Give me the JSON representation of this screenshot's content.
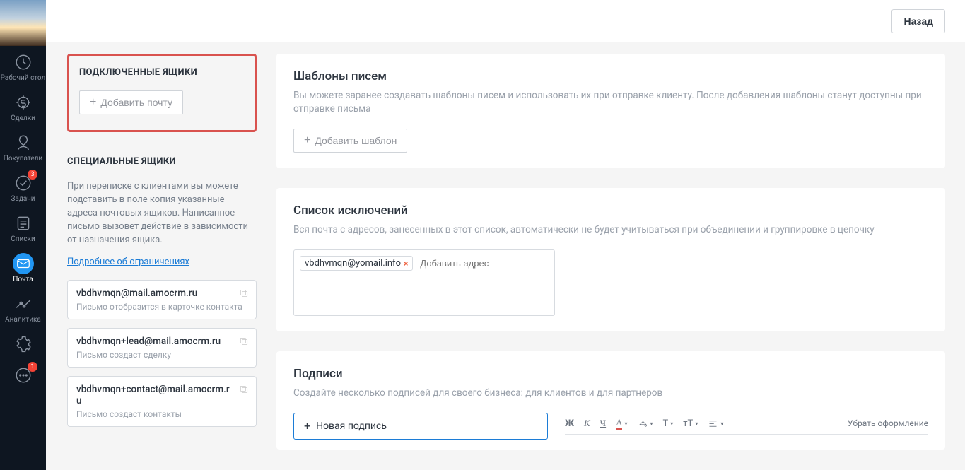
{
  "sidebar": {
    "items": [
      {
        "label": "Рабочий стол",
        "badge": null
      },
      {
        "label": "Сделки",
        "badge": null
      },
      {
        "label": "Покупатели",
        "badge": null
      },
      {
        "label": "Задачи",
        "badge": "3"
      },
      {
        "label": "Списки",
        "badge": null
      },
      {
        "label": "Почта",
        "badge": null
      },
      {
        "label": "Аналитика",
        "badge": null
      },
      {
        "label": "",
        "badge": null
      },
      {
        "label": "",
        "badge": "1"
      }
    ]
  },
  "topbar": {
    "back": "Назад"
  },
  "connected": {
    "title": "ПОДКЛЮЧЕННЫЕ ЯЩИКИ",
    "add_btn": "Добавить почту"
  },
  "special": {
    "title": "СПЕЦИАЛЬНЫЕ ЯЩИКИ",
    "desc": "При переписке с клиентами вы можете подставить в поле копия указанные адреса почтовых ящиков. Написанное письмо вызовет действие в зависимости от назначения ящика.",
    "link": "Подробнее об ограничениях",
    "boxes": [
      {
        "addr": "vbdhvmqn@mail.amocrm.ru",
        "sub": "Письмо отобразится в карточке контакта"
      },
      {
        "addr": "vbdhvmqn+lead@mail.amocrm.ru",
        "sub": "Письмо создаст сделку"
      },
      {
        "addr": "vbdhvmqn+contact@mail.amocrm.ru",
        "sub": "Письмо создаст контакты"
      }
    ]
  },
  "templates": {
    "title": "Шаблоны писем",
    "desc": "Вы можете заранее создавать шаблоны писем и использовать их при отправке клиенту. После добавления шаблоны станут доступны при отправке письма",
    "add_btn": "Добавить шаблон"
  },
  "exclusions": {
    "title": "Список исключений",
    "desc": "Вся почта с адресов, занесенных в этот список, автоматически не будет учитываться при объединении и группировке в цепочку",
    "tag": "vbdhvmqn@yomail.info",
    "placeholder": "Добавить адрес"
  },
  "signatures": {
    "title": "Подписи",
    "desc": "Создайте несколько подписей для своего бизнеса: для клиентов и для партнеров",
    "add_btn": "Новая подпись",
    "toolbar": {
      "bold": "Ж",
      "italic": "К",
      "underline": "Ч",
      "fontcolor": "А",
      "remove": "Убрать оформление"
    }
  }
}
